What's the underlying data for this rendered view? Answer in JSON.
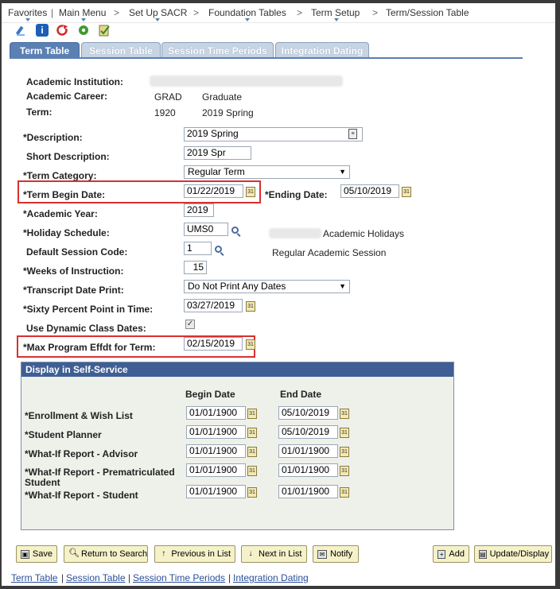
{
  "breadcrumbs": [
    "Favorites",
    "Main Menu",
    "Set Up SACR",
    "Foundation Tables",
    "Term Setup",
    "Term/Session Table"
  ],
  "tabs": [
    "Term Table",
    "Session Table",
    "Session Time Periods",
    "Integration Dating"
  ],
  "header": {
    "institution_label": "Academic Institution:",
    "career_label": "Academic Career:",
    "career_code": "GRAD",
    "career_desc": "Graduate",
    "term_label": "Term:",
    "term_code": "1920",
    "term_desc": "2019 Spring"
  },
  "form": {
    "description_label": "*Description:",
    "description_value": "2019 Spring",
    "short_desc_label": "Short Description:",
    "short_desc_value": "2019 Spr",
    "term_category_label": "*Term Category:",
    "term_category_value": "Regular Term",
    "term_begin_label": "*Term Begin Date:",
    "term_begin_value": "01/22/2019",
    "ending_label": "*Ending Date:",
    "ending_value": "05/10/2019",
    "academic_year_label": "*Academic Year:",
    "academic_year_value": "2019",
    "holiday_label": "*Holiday Schedule:",
    "holiday_value": "UMS0",
    "holiday_desc": "Academic Holidays",
    "session_code_label": "Default Session Code:",
    "session_code_value": "1",
    "session_code_desc": "Regular Academic Session",
    "weeks_label": "*Weeks of Instruction:",
    "weeks_value": "15",
    "transcript_label": "*Transcript Date Print:",
    "transcript_value": "Do Not Print Any Dates",
    "sixty_label": "*Sixty Percent Point in Time:",
    "sixty_value": "03/27/2019",
    "dynamic_label": "Use Dynamic Class Dates:",
    "max_program_label": "*Max Program Effdt for Term:",
    "max_program_value": "02/15/2019"
  },
  "self_service": {
    "title": "Display in Self-Service",
    "begin_header": "Begin Date",
    "end_header": "End Date",
    "rows": [
      {
        "label": "*Enrollment & Wish List",
        "begin": "01/01/1900",
        "end": "05/10/2019"
      },
      {
        "label": "*Student Planner",
        "begin": "01/01/1900",
        "end": "05/10/2019"
      },
      {
        "label": "*What-If Report - Advisor",
        "begin": "01/01/1900",
        "end": "01/01/1900"
      },
      {
        "label": "*What-If Report - Prematriculated Student",
        "begin": "01/01/1900",
        "end": "01/01/1900"
      },
      {
        "label": "*What-If Report - Student",
        "begin": "01/01/1900",
        "end": "01/01/1900"
      }
    ]
  },
  "buttons": {
    "save": "Save",
    "return": "Return to Search",
    "previous": "Previous in List",
    "next": "Next in List",
    "notify": "Notify",
    "add": "Add",
    "update": "Update/Display"
  },
  "footer_links": [
    "Term Table",
    "Session Table",
    "Session Time Periods",
    "Integration Dating"
  ],
  "colors": {
    "accent": "#5b80b3",
    "header_bar": "#3f5e94",
    "highlight": "#d93030"
  }
}
